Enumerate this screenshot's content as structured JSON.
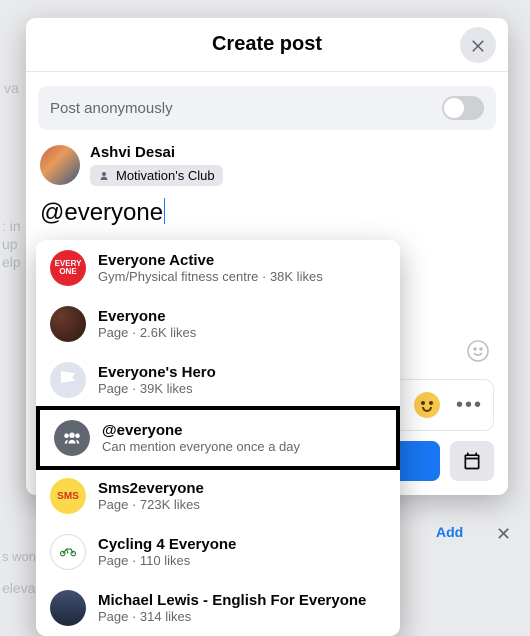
{
  "header": {
    "title": "Create post"
  },
  "anon": {
    "label": "Post anonymously"
  },
  "author": {
    "name": "Ashvi Desai",
    "club": "Motivation's Club"
  },
  "composer": {
    "text": "@everyone"
  },
  "suggestions": [
    {
      "title": "Everyone Active",
      "sub": "Gym/Physical fitness centre · 38K likes"
    },
    {
      "title": "Everyone",
      "sub": "Page · 2.6K likes"
    },
    {
      "title": "Everyone's Hero",
      "sub": "Page · 39K likes"
    },
    {
      "title": "@everyone",
      "sub": "Can mention everyone once a day"
    },
    {
      "title": "Sms2everyone",
      "sub": "Page · 723K likes"
    },
    {
      "title": "Cycling 4 Everyone",
      "sub": "Page · 110 likes"
    },
    {
      "title": "Michael Lewis - English For Everyone",
      "sub": "Page · 314 likes"
    }
  ],
  "bg": {
    "va": "va",
    "in": ": in",
    "up": "up",
    "elp": "elp",
    "add": "Add",
    "x": "✕",
    "won": "s won",
    "eleva": "eleva"
  }
}
